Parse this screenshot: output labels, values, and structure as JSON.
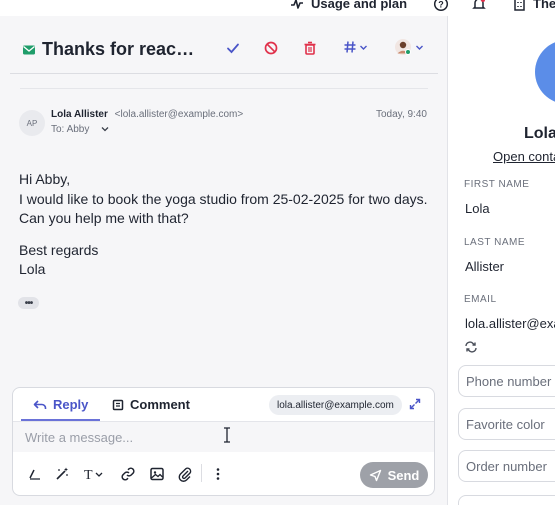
{
  "topbar": {
    "usage_label": "Usage and plan",
    "help_icon": "help-circle-icon",
    "bell_icon": "bell-icon",
    "building_label": "The"
  },
  "conversation": {
    "subject": "Thanks for reaching out",
    "icons": [
      "mail-icon",
      "check-icon",
      "block-icon",
      "trash-icon",
      "hashtag-icon",
      "assignee-avatar-icon"
    ]
  },
  "message": {
    "avatar_initials": "AP",
    "sender_name": "Lola Allister",
    "sender_email": "<lola.allister@example.com>",
    "to": "To: Abby",
    "time": "Today, 9:40",
    "lines": [
      "Hi Abby,",
      "I would like to book the yoga studio from 25-02-2025 for two days. Can you help me with that?",
      "Best regards",
      "Lola"
    ],
    "more_label": "•••"
  },
  "composer": {
    "reply_label": "Reply",
    "comment_label": "Comment",
    "to_email": "lola.allister@example.com",
    "placeholder": "Write a message...",
    "send_label": "Send",
    "tools": [
      "signature-icon",
      "ai-magic-icon",
      "text-format-icon",
      "link-icon",
      "image-icon",
      "attachment-icon",
      "more-vertical-icon"
    ]
  },
  "contact": {
    "name": "Lola",
    "open_contact": "Open contact",
    "fields": [
      {
        "label": "FIRST NAME",
        "value": "Lola"
      },
      {
        "label": "LAST NAME",
        "value": "Allister"
      },
      {
        "label": "EMAIL",
        "value": "lola.allister@example.com"
      }
    ],
    "inputs": [
      {
        "placeholder": "Phone number"
      },
      {
        "placeholder": "Favorite color"
      },
      {
        "placeholder": "Order number"
      }
    ]
  },
  "colors": {
    "accent": "#4a55c8",
    "mail_green": "#1f9d6a",
    "danger": "#e0314b",
    "send_disabled": "#9ea1a8",
    "avatar_blue": "#5b8de8"
  }
}
